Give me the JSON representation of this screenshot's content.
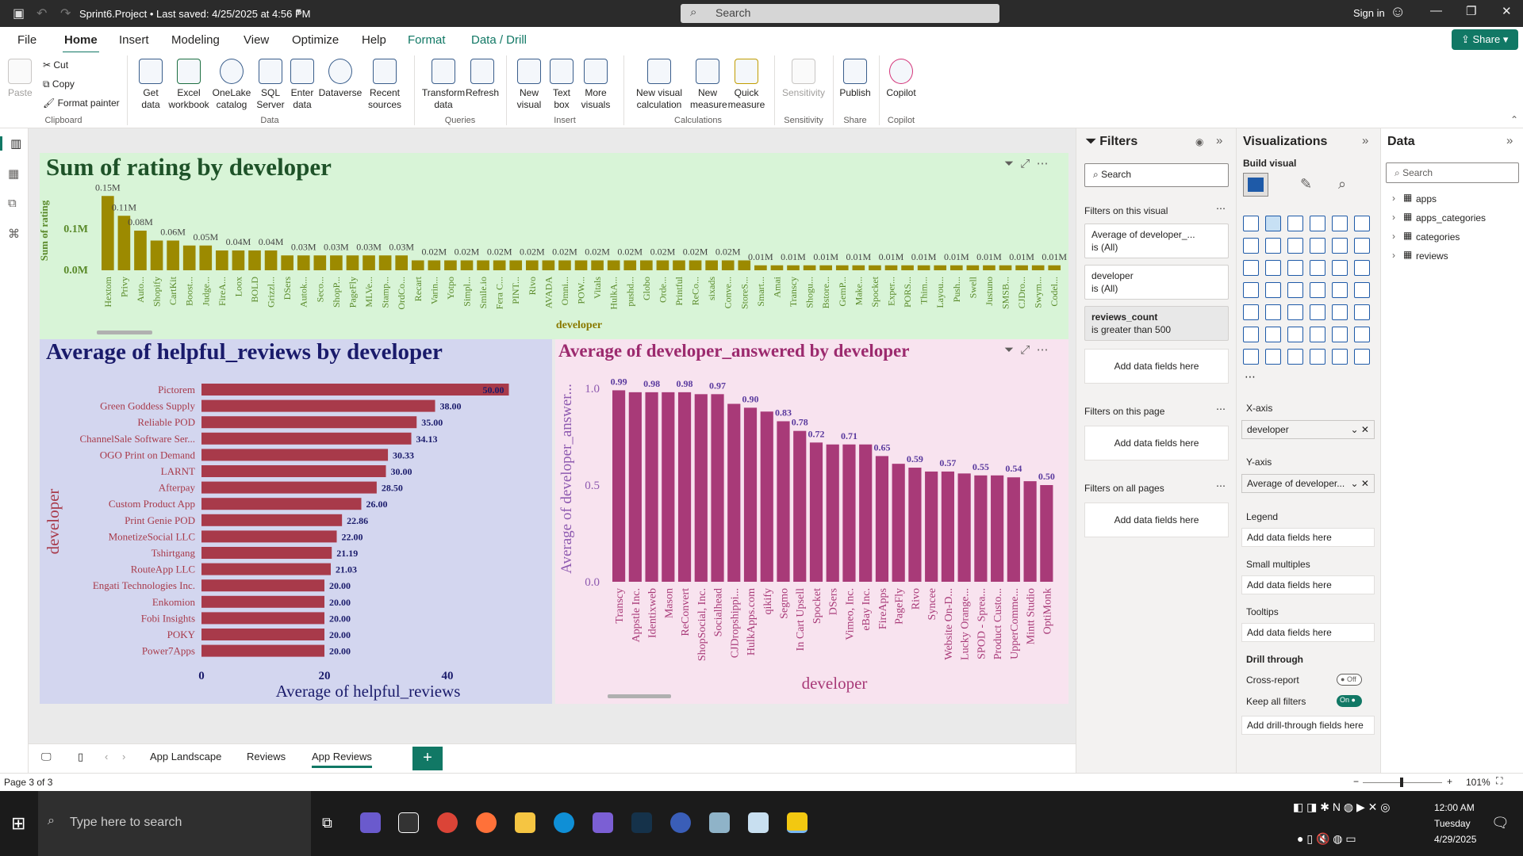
{
  "title_bar": {
    "doc_title": "Sprint6.Project • Last saved: 4/25/2025 at 4:56 PM",
    "search_placeholder": "Search",
    "sign_in": "Sign in"
  },
  "menu": {
    "tabs": [
      "File",
      "Home",
      "Insert",
      "Modeling",
      "View",
      "Optimize",
      "Help",
      "Format",
      "Data / Drill"
    ],
    "share": "Share"
  },
  "ribbon": {
    "clipboard": {
      "paste": "Paste",
      "cut": "Cut",
      "copy": "Copy",
      "format_painter": "Format painter",
      "group": "Clipboard"
    },
    "data": {
      "get_data": "Get data",
      "excel": "Excel workbook",
      "onelake": "OneLake catalog",
      "sql": "SQL Server",
      "enter_data": "Enter data",
      "dataverse": "Dataverse",
      "recent": "Recent sources",
      "group": "Data"
    },
    "queries": {
      "transform": "Transform data",
      "refresh": "Refresh",
      "group": "Queries"
    },
    "insert": {
      "new_visual": "New visual",
      "text_box": "Text box",
      "more_visuals": "More visuals",
      "group": "Insert"
    },
    "calculations": {
      "new_visual_calc": "New visual calculation",
      "new_measure": "New measure",
      "quick_measure": "Quick measure",
      "group": "Calculations"
    },
    "sensitivity": {
      "label": "Sensitivity",
      "group": "Sensitivity"
    },
    "share": {
      "publish": "Publish",
      "group": "Share"
    },
    "copilot": {
      "label": "Copilot",
      "group": "Copilot"
    }
  },
  "chart_data": [
    {
      "type": "bar",
      "title": "Sum of rating by developer",
      "xlabel": "developer",
      "ylabel": "Sum of rating",
      "y_ticks": [
        "0.0M",
        "0.1M"
      ],
      "categories": [
        "Hextom",
        "Privy",
        "Auto...",
        "Shopify",
        "CartKit",
        "Boost...",
        "Judge...",
        "FireA...",
        "Loox",
        "BOLD",
        "Grizzl...",
        "DSers",
        "Autok...",
        "Seco...",
        "ShopP...",
        "PageFly",
        "MLVe...",
        "Stamp...",
        "OrdCo...",
        "Recart",
        "Varin...",
        "Yotpo",
        "Simpl...",
        "Smile.io",
        "Fera C...",
        "PINT...",
        "Rivo",
        "AVADA",
        "Omni...",
        "POW...",
        "Vitals",
        "HulkA...",
        "pushd...",
        "Globo",
        "Orde...",
        "Printful",
        "ReCo...",
        "sixads",
        "Conve...",
        "StoreS...",
        "Smart...",
        "Amai",
        "Transcy",
        "Shogu...",
        "Bstore...",
        "GemP...",
        "Make...",
        "Spocket",
        "Exper...",
        "PORS...",
        "Thim...",
        "Layou...",
        "Push...",
        "Swell",
        "Justuno",
        "SMSB...",
        "CJDro...",
        "Swym...",
        "Codel..."
      ],
      "values": [
        0.15,
        0.11,
        0.08,
        0.06,
        0.06,
        0.05,
        0.05,
        0.04,
        0.04,
        0.04,
        0.04,
        0.03,
        0.03,
        0.03,
        0.03,
        0.03,
        0.03,
        0.03,
        0.03,
        0.02,
        0.02,
        0.02,
        0.02,
        0.02,
        0.02,
        0.02,
        0.02,
        0.02,
        0.02,
        0.02,
        0.02,
        0.02,
        0.02,
        0.02,
        0.02,
        0.02,
        0.02,
        0.02,
        0.02,
        0.02,
        0.01,
        0.01,
        0.01,
        0.01,
        0.01,
        0.01,
        0.01,
        0.01,
        0.01,
        0.01,
        0.01,
        0.01,
        0.01,
        0.01,
        0.01,
        0.01,
        0.01,
        0.01,
        0.01
      ],
      "labels": [
        "0.15M",
        "0.11M",
        "0.08M",
        "",
        "0.06M",
        "",
        "0.05M",
        "",
        "0.04M",
        "",
        "0.04M",
        "",
        "0.03M",
        "",
        "0.03M",
        "",
        "0.03M",
        "",
        "0.03M",
        "",
        "0.02M",
        "",
        "0.02M",
        "",
        "0.02M",
        "",
        "0.02M",
        "",
        "0.02M",
        "",
        "0.02M",
        "",
        "0.02M",
        "",
        "0.02M",
        "",
        "0.02M",
        "",
        "0.02M",
        "",
        "0.01M",
        "",
        "0.01M",
        "",
        "0.01M",
        "",
        "0.01M",
        "",
        "0.01M",
        "",
        "0.01M",
        "",
        "0.01M",
        "",
        "0.01M",
        "",
        "0.01M",
        "",
        "0.01M",
        "",
        "0.01M"
      ],
      "ylim": [
        0,
        0.16
      ]
    },
    {
      "type": "bar",
      "orientation": "horizontal",
      "title": "Average of helpful_reviews by developer",
      "xlabel": "Average of helpful_reviews",
      "ylabel": "developer",
      "x_ticks": [
        0,
        20,
        40
      ],
      "categories": [
        "Pictorem",
        "Green Goddess Supply",
        "Reliable POD",
        "ChannelSale Software Ser...",
        "OGO Print on Demand",
        "LARNT",
        "Afterpay",
        "Custom Product App",
        "Print Genie POD",
        "MonetizeSocial LLC",
        "Tshirtgang",
        "RouteApp LLC",
        "Engati Technologies Inc.",
        "Enkomion",
        "Fobi Insights",
        "POKY",
        "Power7Apps"
      ],
      "values": [
        50.0,
        38.0,
        35.0,
        34.13,
        30.33,
        30.0,
        28.5,
        26.0,
        22.86,
        22.0,
        21.19,
        21.03,
        20.0,
        20.0,
        20.0,
        20.0,
        20.0
      ],
      "labels": [
        "50.00",
        "38.00",
        "35.00",
        "34.13",
        "30.33",
        "30.00",
        "28.50",
        "26.00",
        "22.86",
        "22.00",
        "21.19",
        "21.03",
        "20.00",
        "20.00",
        "20.00",
        "20.00",
        "20.00"
      ],
      "xlim": [
        0,
        55
      ]
    },
    {
      "type": "bar",
      "title": "Average of developer_answered by developer",
      "xlabel": "developer",
      "ylabel": "Average of developer_answer...",
      "y_ticks": [
        "0.0",
        "0.5",
        "1.0"
      ],
      "categories": [
        "Transcy",
        "Appstle Inc.",
        "Identixweb",
        "Mason",
        "ReConvert",
        "ShopSocial, Inc.",
        "Socialhead",
        "CJDropshippi...",
        "HulkApps.com",
        "qikify",
        "Segmo",
        "In Cart Upsell",
        "Spocket",
        "DSers",
        "Vimeo, Inc.",
        "eBay Inc.",
        "FireApps",
        "PageFly",
        "Rivo",
        "Syncee",
        "Website On-D...",
        "Lucky Orange...",
        "SPOD - Sprea...",
        "Product Custo...",
        "UpperComme...",
        "Mintt Studio",
        "OptiMonk"
      ],
      "values": [
        0.99,
        0.98,
        0.98,
        0.98,
        0.98,
        0.97,
        0.97,
        0.92,
        0.9,
        0.88,
        0.83,
        0.78,
        0.72,
        0.71,
        0.71,
        0.71,
        0.65,
        0.61,
        0.59,
        0.57,
        0.57,
        0.56,
        0.55,
        0.55,
        0.54,
        0.52,
        0.5
      ],
      "labels": [
        "0.99",
        "",
        "0.98",
        "",
        "0.98",
        "",
        "0.97",
        "",
        "0.90",
        "",
        "0.83",
        "0.78",
        "0.72",
        "",
        "0.71",
        "",
        "0.65",
        "",
        "0.59",
        "",
        "0.57",
        "",
        "0.55",
        "",
        "0.54",
        "",
        "0.50"
      ],
      "ylim": [
        0,
        1.1
      ]
    }
  ],
  "filters": {
    "title": "Filters",
    "search_placeholder": "Search",
    "on_visual": "Filters on this visual",
    "cards": [
      {
        "name": "Average of developer_...",
        "value": "is (All)"
      },
      {
        "name": "developer",
        "value": "is (All)"
      },
      {
        "name": "reviews_count",
        "value": "is greater than 500"
      }
    ],
    "add_fields": "Add data fields here",
    "on_page": "Filters on this page",
    "on_all": "Filters on all pages"
  },
  "viz": {
    "title": "Visualizations",
    "build": "Build visual",
    "x_axis": "X-axis",
    "x_value": "developer",
    "y_axis": "Y-axis",
    "y_value": "Average of developer...",
    "legend": "Legend",
    "small_multiples": "Small multiples",
    "tooltips": "Tooltips",
    "drill_through": "Drill through",
    "cross_report": "Cross-report",
    "cross_state": "Off",
    "keep_filters": "Keep all filters",
    "keep_state": "On",
    "add_fields": "Add data fields here",
    "add_drill": "Add drill-through fields here"
  },
  "data_pane": {
    "title": "Data",
    "search_placeholder": "Search",
    "tables": [
      "apps",
      "apps_categories",
      "categories",
      "reviews"
    ]
  },
  "pages": {
    "tabs": [
      "App Landscape",
      "Reviews",
      "App Reviews"
    ],
    "status": "Page 3 of 3",
    "zoom": "101%"
  },
  "taskbar": {
    "search": "Type here to search",
    "time": "12:00 AM",
    "day": "Tuesday",
    "date": "4/29/2025"
  }
}
